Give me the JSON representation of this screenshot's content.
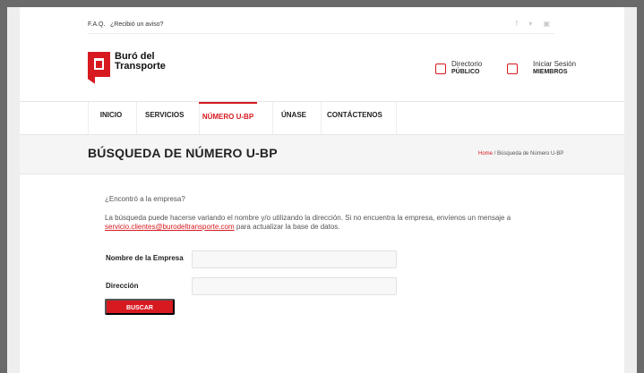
{
  "top": {
    "faq": "F.A.Q.",
    "notice": "¿Recibió un aviso?",
    "social": "f  ▾  ▣"
  },
  "brand": {
    "name_line1": "Buró del",
    "name_line2": "Transporte",
    "accent": "#d71920"
  },
  "header": {
    "directory_label": "Directorio",
    "directory_sub": "PÚBLICO",
    "login_label": "Iniciar Sesión",
    "login_sub": "MIEMBROS"
  },
  "nav": {
    "items": [
      {
        "label": "INICIO"
      },
      {
        "label": "SERVICIOS"
      },
      {
        "label": "NÚMERO U-BP"
      },
      {
        "label": "ÚNASE"
      },
      {
        "label": "CONTÁCTENOS"
      }
    ]
  },
  "page": {
    "title": "BÚSQUEDA DE NÚMERO U-BP",
    "breadcrumb_home": "Home",
    "breadcrumb_current": " / Búsqueda de Número U-BP"
  },
  "content": {
    "question": "¿Encontró a la empresa?",
    "description": "La búsqueda puede hacerse variando el nombre y/o utilizando la dirección. Si no encuentra la empresa, envíenos un mensaje a",
    "email": "servicio.clientes@burodeltransporte.com",
    "description_end": " para actualizar la base de datos."
  },
  "form": {
    "company_label": "Nombre de la Empresa",
    "company_value": "",
    "address_label": "Dirección",
    "address_value": "",
    "button": "BUSCAR"
  }
}
